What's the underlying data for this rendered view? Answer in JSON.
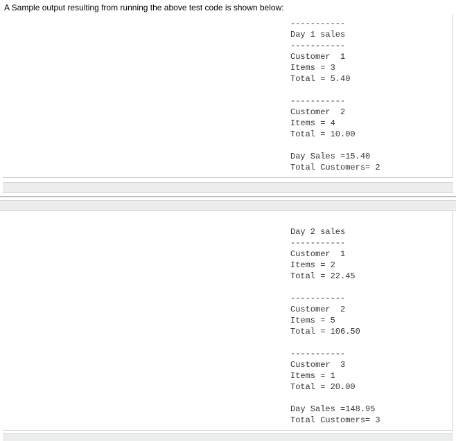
{
  "intro": "A Sample output resulting from running the above test code is shown below:",
  "day1": {
    "sep": "-----------",
    "title": "Day 1 sales",
    "customers": [
      {
        "header": "Customer  1",
        "items": "Items = 3",
        "total": "Total = 5.40"
      },
      {
        "header": "Customer  2",
        "items": "Items = 4",
        "total": "Total = 10.00"
      }
    ],
    "daySales": "Day Sales =15.40",
    "totalCust": "Total Customers= 2"
  },
  "day2": {
    "sep": "-----------",
    "title": "Day 2 sales",
    "customers": [
      {
        "header": "Customer  1",
        "items": "Items = 2",
        "total": "Total = 22.45"
      },
      {
        "header": "Customer  2",
        "items": "Items = 5",
        "total": "Total = 106.50"
      },
      {
        "header": "Customer  3",
        "items": "Items = 1",
        "total": "Total = 20.00"
      }
    ],
    "daySales": "Day Sales =148.95",
    "totalCust": "Total Customers= 3"
  }
}
